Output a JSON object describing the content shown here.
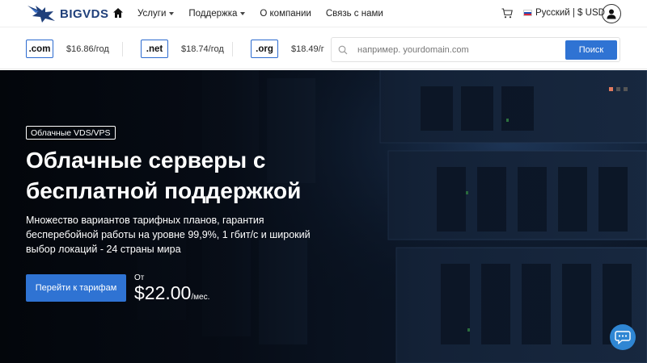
{
  "brand": {
    "name": "BIGVDS"
  },
  "nav": {
    "menu": [
      {
        "label": "Услуги",
        "dropdown": true
      },
      {
        "label": "Поддержка",
        "dropdown": true
      },
      {
        "label": "О компании",
        "dropdown": false
      },
      {
        "label": "Связь с нами",
        "dropdown": false
      }
    ],
    "language_currency": "Русский | $ USD"
  },
  "domains": [
    {
      "tld": ".com",
      "price": "$16.86/год"
    },
    {
      "tld": ".net",
      "price": "$18.74/год"
    },
    {
      "tld": ".org",
      "price": "$18.49/г"
    }
  ],
  "search": {
    "placeholder": "например. yourdomain.com",
    "button": "Поиск"
  },
  "hero": {
    "badge": "Облачные VDS/VPS",
    "title_line1": "Облачные серверы с",
    "title_line2": "бесплатной поддержкой",
    "description": "Множество вариантов тарифных планов, гарантия бесперебойной работы на уровне 99,9%, 1 гбит/с и широкий выбор локаций - 24 страны мира",
    "cta": "Перейти к тарифам",
    "from_label": "От",
    "price": "$22.00",
    "per": "/мес."
  },
  "colors": {
    "accent": "#2f73d3",
    "brand": "#1f3f7a",
    "hero_bg": "#06090f",
    "active_dot": "#e07a5f"
  },
  "icons": [
    "logo-mark-icon",
    "home-icon",
    "cart-icon",
    "flag-ru-icon",
    "user-icon",
    "search-icon",
    "chat-icon"
  ]
}
